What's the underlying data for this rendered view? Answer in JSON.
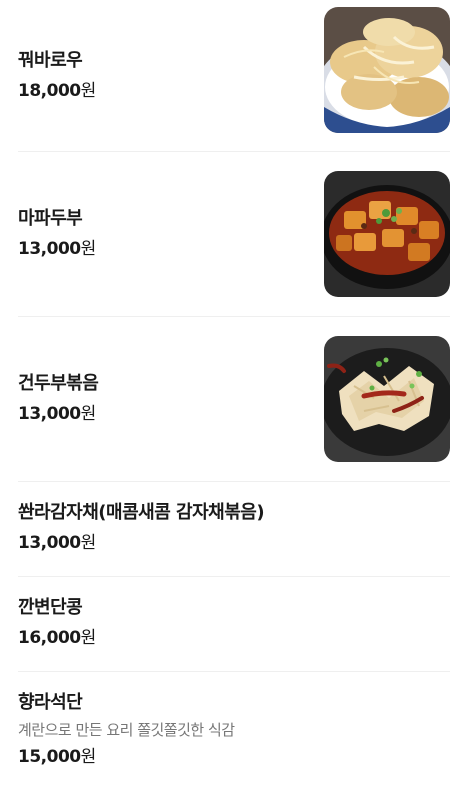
{
  "menu": {
    "items": [
      {
        "name": "꿔바로우",
        "price": "18,000",
        "unit": "원",
        "image": "guobaorou-photo"
      },
      {
        "name": "마파두부",
        "price": "13,000",
        "unit": "원",
        "image": "mapo-tofu-photo"
      },
      {
        "name": "건두부볶음",
        "price": "13,000",
        "unit": "원",
        "image": "dried-tofu-stirfry-photo"
      },
      {
        "name": "쏸라감자채(매콤새콤 감자채볶음)",
        "price": "13,000",
        "unit": "원"
      },
      {
        "name": "깐변단콩",
        "price": "16,000",
        "unit": "원"
      },
      {
        "name": "향라석단",
        "description": "계란으로 만든 요리 쫄깃쫄깃한 식감",
        "price": "15,000",
        "unit": "원"
      }
    ]
  }
}
